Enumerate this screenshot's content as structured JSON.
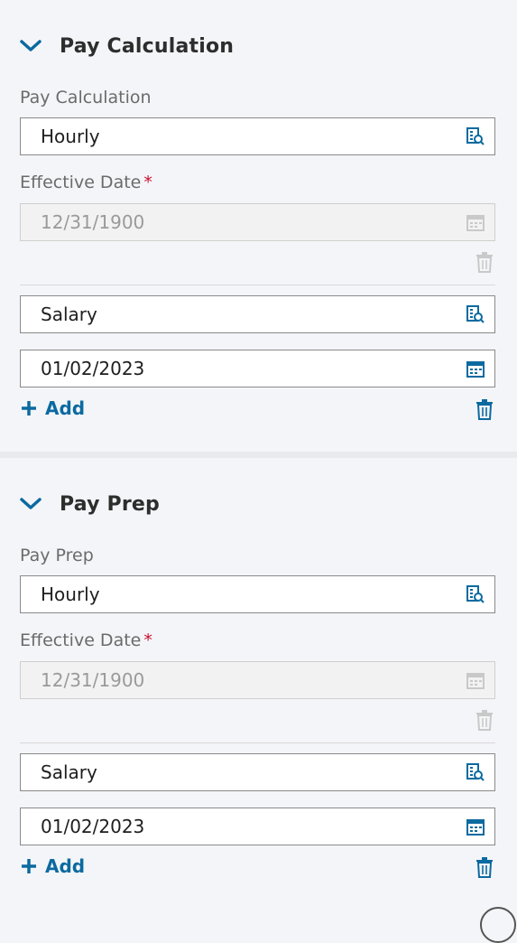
{
  "pay_calculation": {
    "title": "Pay Calculation",
    "field_label": "Pay Calculation",
    "effective_date_label": "Effective Date",
    "required_mark": "*",
    "rows": [
      {
        "value": "Hourly",
        "date": "12/31/1900",
        "date_disabled": true
      },
      {
        "value": "Salary",
        "date": "01/02/2023",
        "date_disabled": false
      }
    ],
    "add_label": "Add"
  },
  "pay_prep": {
    "title": "Pay Prep",
    "field_label": "Pay Prep",
    "effective_date_label": "Effective Date",
    "required_mark": "*",
    "rows": [
      {
        "value": "Hourly",
        "date": "12/31/1900",
        "date_disabled": true
      },
      {
        "value": "Salary",
        "date": "01/02/2023",
        "date_disabled": false
      }
    ],
    "add_label": "Add"
  },
  "icons": {
    "chevron": "chevron-down-icon",
    "lookup": "lookup-search-icon",
    "calendar": "calendar-icon",
    "delete": "trash-icon",
    "add": "plus-icon"
  },
  "colors": {
    "accent": "#0b6aa0",
    "required": "#c8102e",
    "background": "#f4f5f8"
  }
}
